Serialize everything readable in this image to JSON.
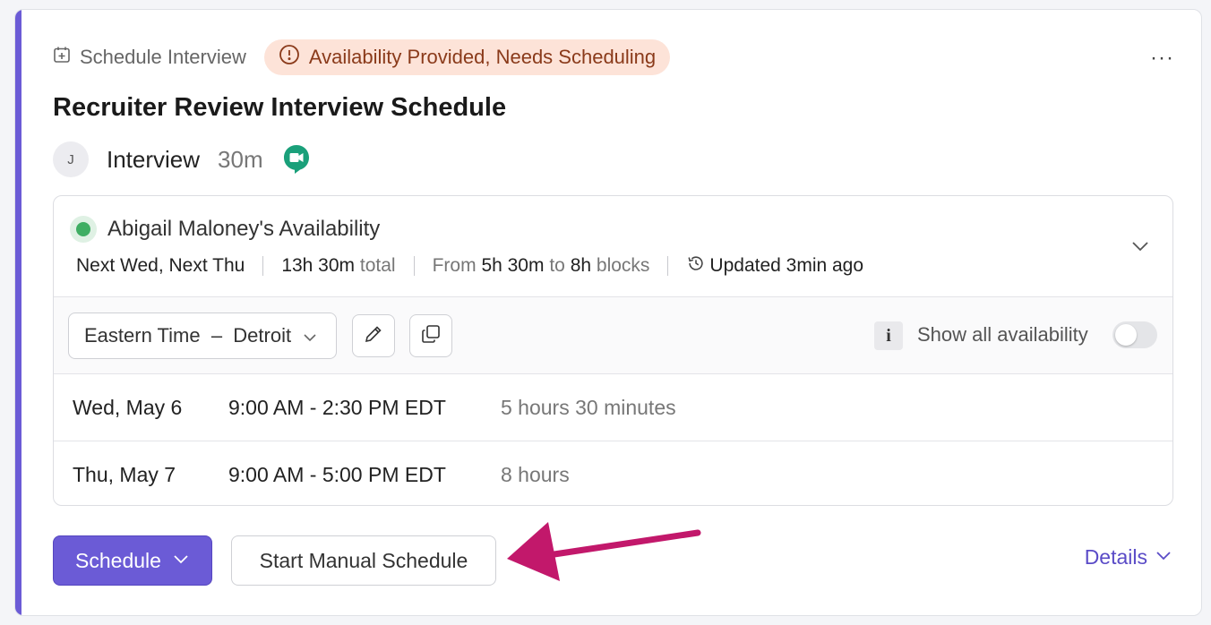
{
  "colors": {
    "accent": "#6b5bd6",
    "status_bg": "#fde3d8",
    "status_text": "#8a3a1a",
    "available_dot": "#3fae63",
    "annotation_arrow": "#c2186b"
  },
  "header": {
    "task_type": "Schedule Interview",
    "task_type_icon": "calendar-plus-icon",
    "status": "Availability Provided, Needs Scheduling",
    "status_icon": "alert-circle-icon",
    "more_label": "···"
  },
  "title": "Recruiter Review Interview Schedule",
  "interview": {
    "avatar_initial": "J",
    "label": "Interview",
    "duration": "30m",
    "video_icon": "google-meet-icon"
  },
  "availability": {
    "title": "Abigail Maloney's Availability",
    "days": "Next Wed, Next Thu",
    "total_value": "13h 30m",
    "total_suffix": "total",
    "blocks_prefix": "From",
    "blocks_min": "5h 30m",
    "blocks_to": "to",
    "blocks_max": "8h",
    "blocks_suffix": "blocks",
    "updated": "Updated 3min ago",
    "timezone": "Eastern Time  –  Detroit",
    "show_all_label": "Show all availability",
    "show_all_enabled": false,
    "info_label": "i",
    "slots": [
      {
        "date": "Wed, May 6",
        "time": "9:00 AM - 2:30 PM EDT",
        "duration": "5 hours 30 minutes"
      },
      {
        "date": "Thu, May 7",
        "time": "9:00 AM - 5:00 PM EDT",
        "duration": "8 hours"
      }
    ]
  },
  "actions": {
    "schedule_label": "Schedule",
    "manual_label": "Start Manual Schedule",
    "details_label": "Details"
  }
}
